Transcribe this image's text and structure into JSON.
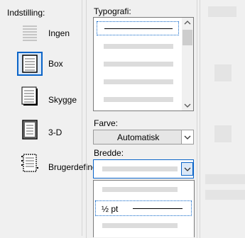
{
  "setting": {
    "title": "Indstilling:",
    "items": [
      {
        "label": "Ingen",
        "icon": "no-border-icon"
      },
      {
        "label": "Box",
        "icon": "box-border-icon"
      },
      {
        "label": "Skygge",
        "icon": "shadow-border-icon"
      },
      {
        "label": "3-D",
        "icon": "3d-border-icon"
      },
      {
        "label": "Brugerdefineret",
        "icon": "custom-border-icon"
      }
    ],
    "selected": "Box"
  },
  "style": {
    "title": "Typografi:"
  },
  "color": {
    "label": "Farve:",
    "value": "Automatisk"
  },
  "width": {
    "label": "Bredde:",
    "highlighted_option": "½ pt"
  },
  "colors": {
    "accent": "#0a64c8",
    "selected_bg": "#dbe8f7",
    "placeholder": "#dcdcdc"
  }
}
